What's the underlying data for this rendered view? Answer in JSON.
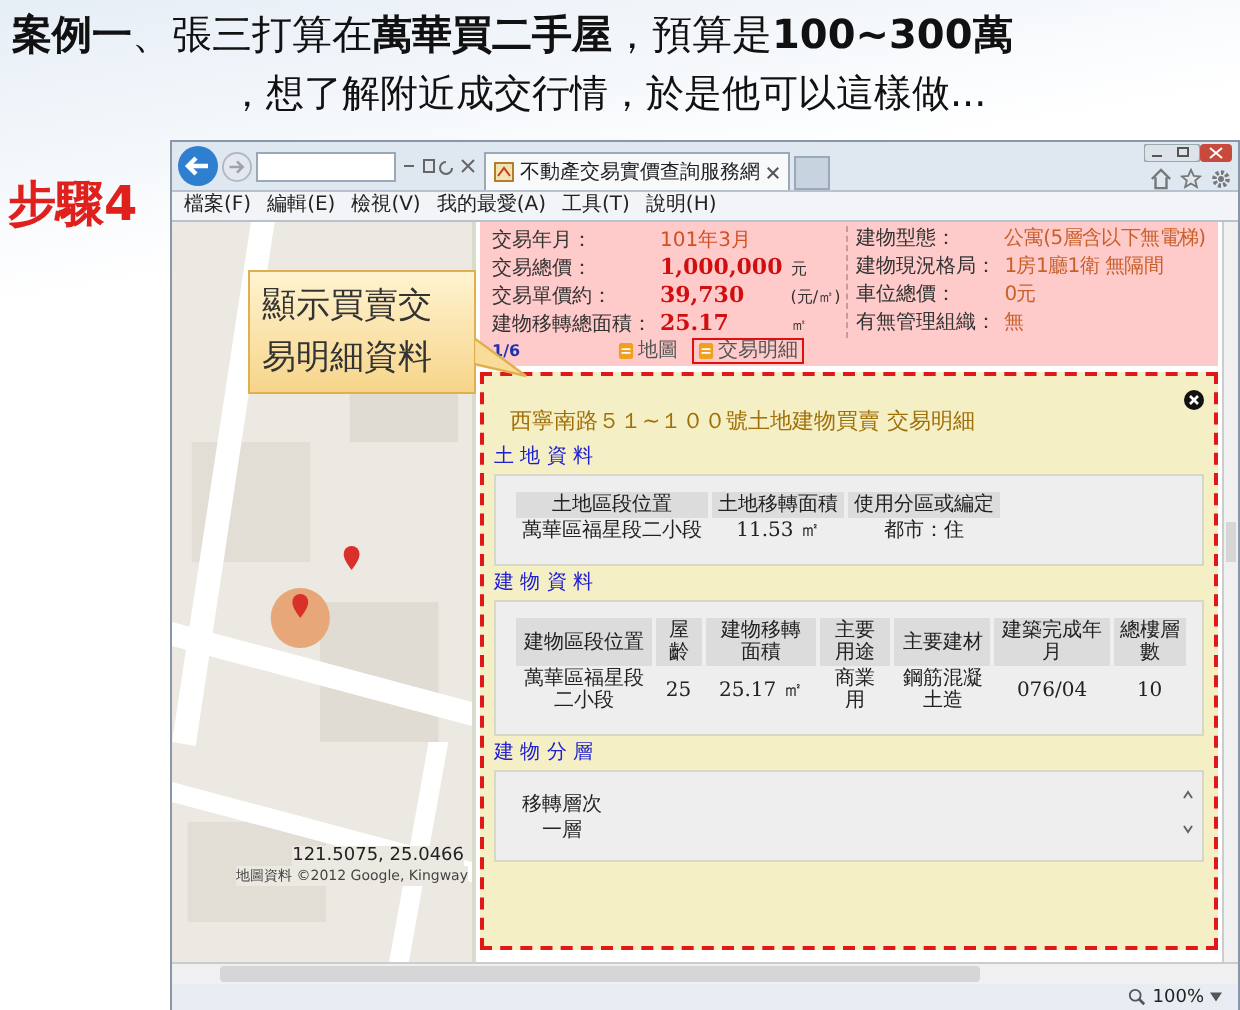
{
  "slide": {
    "heading_lines": [
      "**案例一**、張三打算在**萬華買二手屋**，預算是**100~300萬**",
      "，想了解附近成交行情，於是他可以這樣做..."
    ],
    "step_label": "步驟4",
    "callout": "顯示買賣交易明細資料"
  },
  "browser": {
    "tab_title": "不動產交易實價查詢服務網",
    "menu": [
      "檔案(F)",
      "編輯(E)",
      "檢視(V)",
      "我的最愛(A)",
      "工具(T)",
      "說明(H)"
    ],
    "zoom": "100%"
  },
  "map": {
    "kind": "picture",
    "coordinates": "121.5075, 25.0466",
    "credit": "地圖資料 ©2012 Google, Kingway"
  },
  "summary": {
    "left": [
      {
        "kind": "plain",
        "label": "交易年月：",
        "value": "101年3月"
      },
      {
        "kind": "figure",
        "label": "交易總價：",
        "value": "1,000,000",
        "unit": "元"
      },
      {
        "kind": "figure",
        "label": "交易單價約：",
        "value": "39,730",
        "unit": "(元/㎡)"
      },
      {
        "kind": "figure",
        "label": "建物移轉總面積：",
        "value": "25.17",
        "unit": "㎡"
      }
    ],
    "right": [
      {
        "label": "建物型態：",
        "value": "公寓(5層含以下無電梯)"
      },
      {
        "label": "建物現況格局：",
        "value": "1房1廳1衛 無隔間"
      },
      {
        "label": "車位總價：",
        "value": "0元"
      },
      {
        "label": "有無管理組織：",
        "value": "無"
      }
    ],
    "page": "1/6",
    "actions": [
      {
        "label": "地圖",
        "selected": false
      },
      {
        "label": "交易明細",
        "selected": true
      }
    ]
  },
  "detail": {
    "title": "西寧南路５１~１００號土地建物買賣 交易明細",
    "sections": [
      {
        "kind": "grid",
        "heading": "土 地 資 料",
        "columns": [
          "土地區段位置",
          "土地移轉面積",
          "使用分區或編定"
        ],
        "rows": [
          [
            "萬華區福星段二小段",
            "11.53 ㎡",
            "都市：住"
          ]
        ]
      },
      {
        "kind": "grid",
        "heading": "建 物 資 料",
        "columns": [
          "建物區段位置",
          "屋齡",
          "建物移轉面積",
          "主要用途",
          "主要建材",
          "建築完成年月",
          "總樓層數"
        ],
        "rows": [
          [
            "萬華區福星段二小段",
            "25",
            "25.17 ㎡",
            "商業用",
            "鋼筋混凝土造",
            "076/04",
            "10"
          ]
        ]
      },
      {
        "kind": "list",
        "heading": "建 物 分 層",
        "columns": [
          "移轉層次"
        ],
        "rows": [
          [
            "一層"
          ]
        ]
      }
    ]
  }
}
